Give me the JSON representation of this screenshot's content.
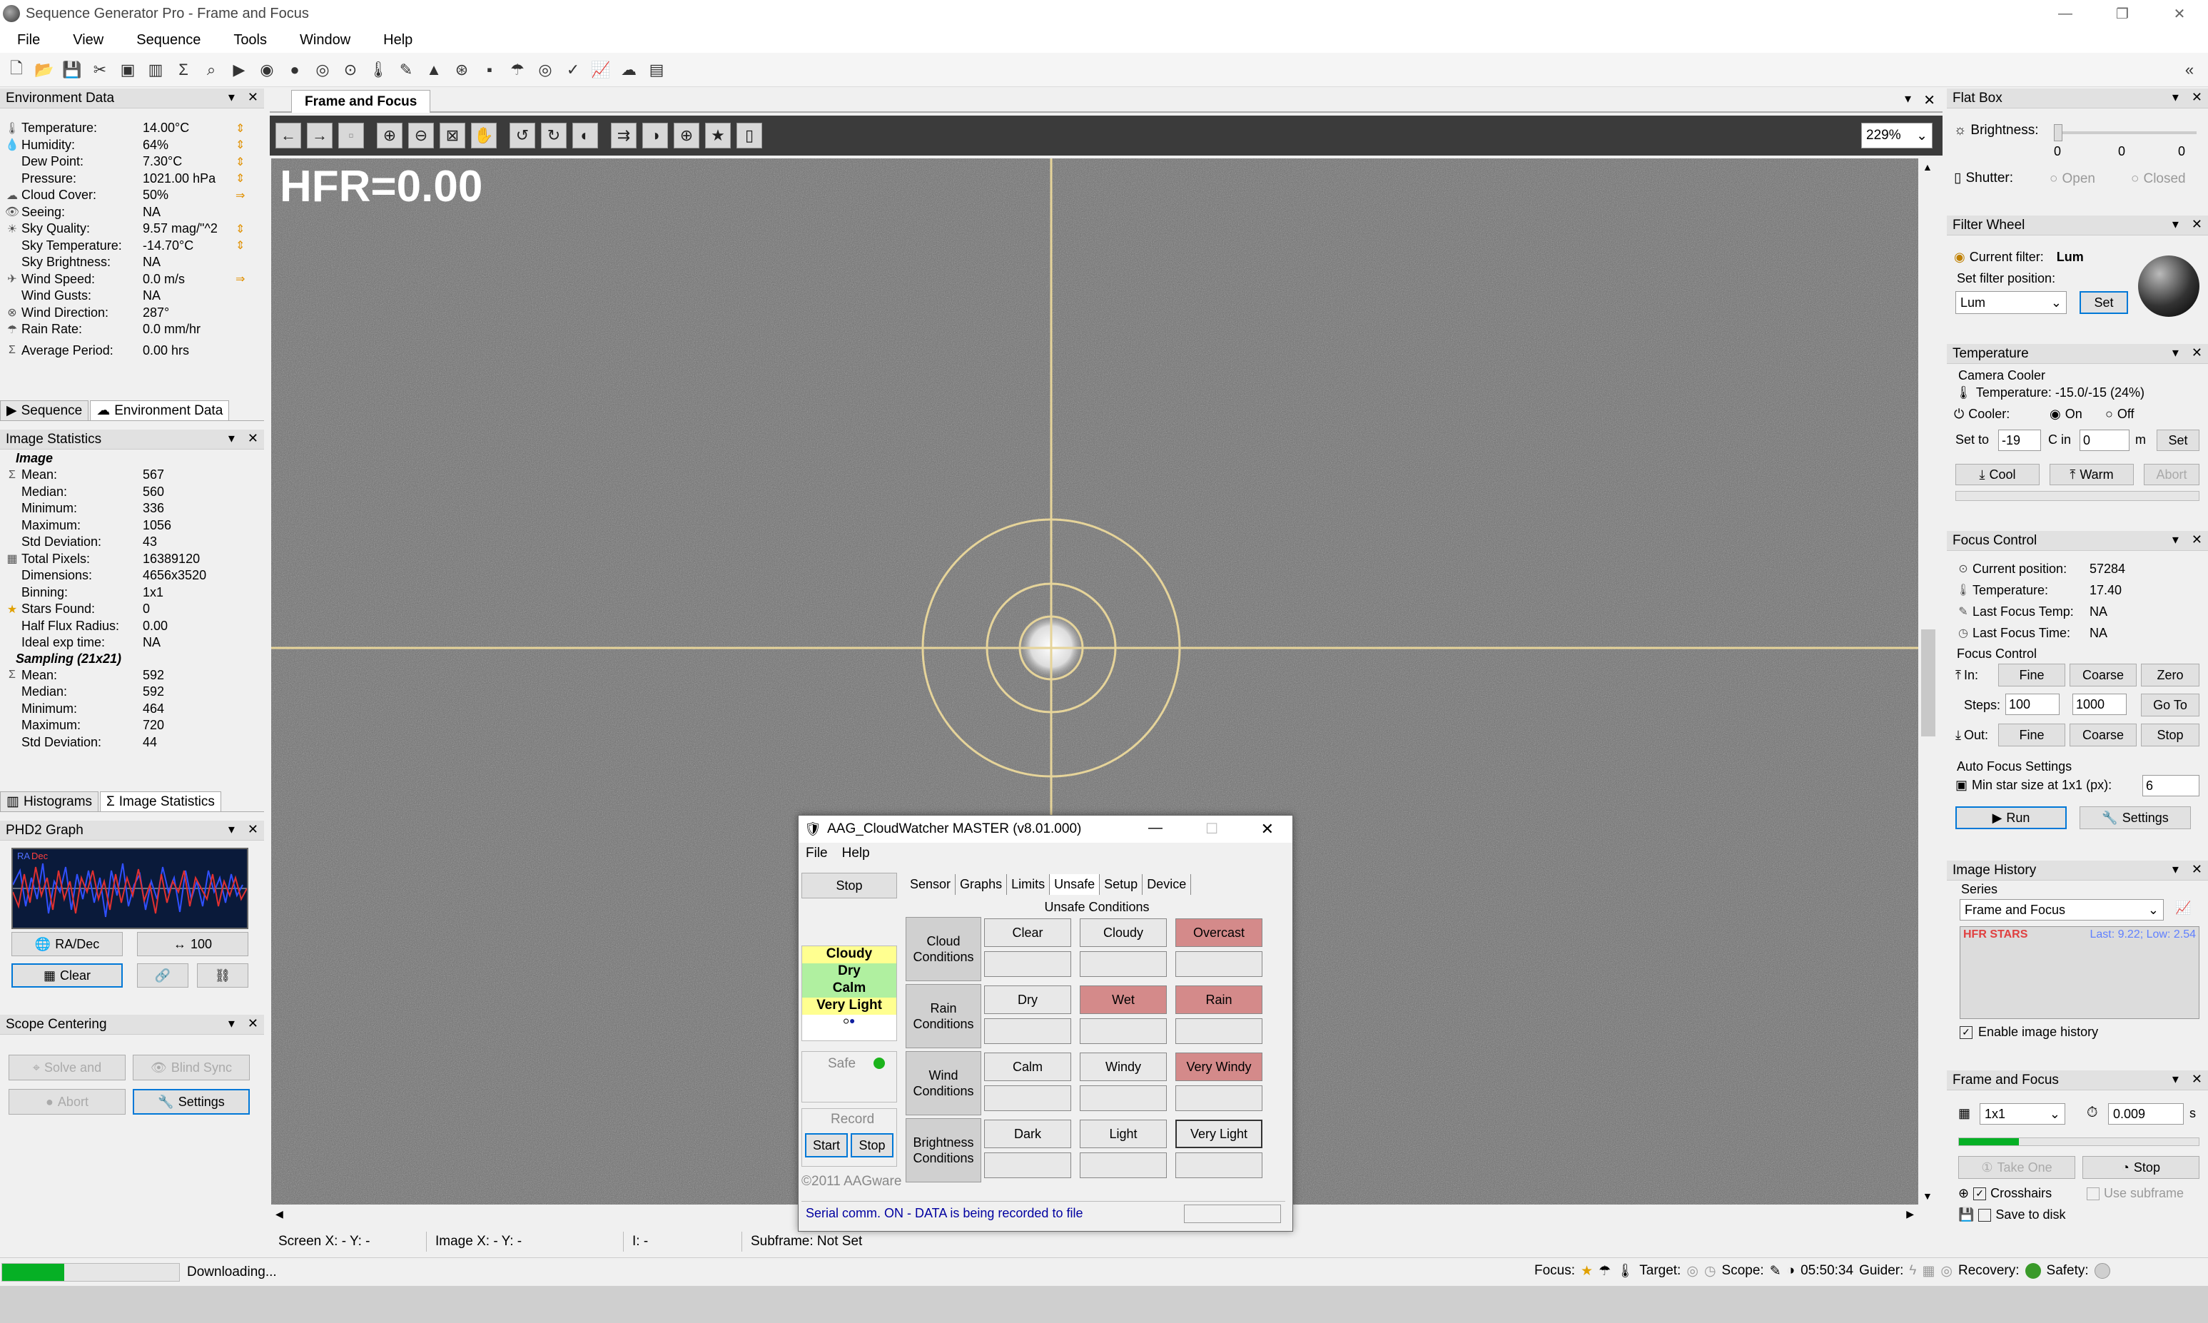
{
  "window": {
    "title": "Sequence Generator Pro - Frame and Focus"
  },
  "menu": [
    "File",
    "View",
    "Sequence",
    "Tools",
    "Window",
    "Help"
  ],
  "env": {
    "title": "Environment Data",
    "rows": [
      {
        "label": "Temperature:",
        "value": "14.00°C"
      },
      {
        "label": "Humidity:",
        "value": "64%"
      },
      {
        "label": "Dew Point:",
        "value": "7.30°C"
      },
      {
        "label": "Pressure:",
        "value": "1021.00 hPa"
      },
      {
        "label": "Cloud Cover:",
        "value": "50%"
      },
      {
        "label": "Seeing:",
        "value": "NA"
      },
      {
        "label": "Sky Quality:",
        "value": "9.57 mag/\"^2"
      },
      {
        "label": "Sky Temperature:",
        "value": "-14.70°C"
      },
      {
        "label": "Sky Brightness:",
        "value": "NA"
      },
      {
        "label": "Wind Speed:",
        "value": "0.0 m/s"
      },
      {
        "label": "Wind Gusts:",
        "value": "NA"
      },
      {
        "label": "Wind Direction:",
        "value": "287°"
      },
      {
        "label": "Rain Rate:",
        "value": "0.0 mm/hr"
      }
    ],
    "avg_label": "Average Period:",
    "avg_value": "0.00 hrs",
    "tab1": "Sequence",
    "tab2": "Environment Data"
  },
  "imgstats": {
    "title": "Image Statistics",
    "image_hdr": "Image",
    "rows": [
      {
        "label": "Mean:",
        "value": "567"
      },
      {
        "label": "Median:",
        "value": "560"
      },
      {
        "label": "Minimum:",
        "value": "336"
      },
      {
        "label": "Maximum:",
        "value": "1056"
      },
      {
        "label": "Std Deviation:",
        "value": "43"
      },
      {
        "label": "Total Pixels:",
        "value": "16389120"
      },
      {
        "label": "Dimensions:",
        "value": "4656x3520"
      },
      {
        "label": "Binning:",
        "value": "1x1"
      },
      {
        "label": "Stars Found:",
        "value": "0"
      },
      {
        "label": "Half Flux Radius:",
        "value": "0.00"
      },
      {
        "label": "Ideal exp time:",
        "value": "NA"
      }
    ],
    "sampling_hdr": "Sampling (21x21)",
    "srows": [
      {
        "label": "Mean:",
        "value": "592"
      },
      {
        "label": "Median:",
        "value": "592"
      },
      {
        "label": "Minimum:",
        "value": "464"
      },
      {
        "label": "Maximum:",
        "value": "720"
      },
      {
        "label": "Std Deviation:",
        "value": "44"
      }
    ],
    "tab1": "Histograms",
    "tab2": "Image Statistics"
  },
  "phd2": {
    "title": "PHD2 Graph",
    "ra": "RA",
    "dec": "Dec",
    "radec_btn": "RA/Dec",
    "scale_btn": "100",
    "clear_btn": "Clear"
  },
  "scope": {
    "title": "Scope Centering",
    "solve": "Solve and",
    "blind": "Blind Sync",
    "abort": "Abort",
    "settings": "Settings"
  },
  "doc": {
    "tab": "Frame and Focus",
    "zoom": "229%",
    "hfr": "HFR=0.00"
  },
  "statusline": {
    "screen": "Screen X: - Y: -",
    "image": "Image X: - Y: -",
    "i": "I: -",
    "subframe": "Subframe: Not Set"
  },
  "flatbox": {
    "title": "Flat Box",
    "brightness": "Brightness:",
    "b_vals": [
      "0",
      "0",
      "0"
    ],
    "shutter": "Shutter:",
    "open": "Open",
    "closed": "Closed"
  },
  "filter": {
    "title": "Filter Wheel",
    "current_lbl": "Current filter:",
    "current": "Lum",
    "set_lbl": "Set filter position:",
    "select": "Lum",
    "set_btn": "Set"
  },
  "temp": {
    "title": "Temperature",
    "cam": "Camera Cooler",
    "temp_line": "Temperature: -15.0/-15 (24%)",
    "cooler": "Cooler:",
    "on": "On",
    "off": "Off",
    "setto": "Set to",
    "setval": "-19",
    "cin": "C in",
    "minval": "0",
    "m": "m",
    "set_btn": "Set",
    "cool": "Cool",
    "warm": "Warm",
    "abort": "Abort"
  },
  "focus": {
    "title": "Focus Control",
    "rows": [
      {
        "label": "Current position:",
        "value": "57284"
      },
      {
        "label": "Temperature:",
        "value": "17.40"
      },
      {
        "label": "Last Focus Temp:",
        "value": "NA"
      },
      {
        "label": "Last Focus Time:",
        "value": "NA"
      }
    ],
    "fc": "Focus Control",
    "in": "In:",
    "fine": "Fine",
    "coarse": "Coarse",
    "zero": "Zero",
    "steps": "Steps:",
    "s1": "100",
    "s2": "1000",
    "goto": "Go To",
    "out": "Out:",
    "stop": "Stop",
    "afs": "Auto Focus Settings",
    "minstar": "Min star size at 1x1 (px):",
    "minstar_val": "6",
    "run": "Run",
    "settings": "Settings"
  },
  "history": {
    "title": "Image History",
    "series_lbl": "Series",
    "series": "Frame and Focus",
    "legend": "HFR  STARS",
    "last": "Last: 9.22; Low: 2.54",
    "enable": "Enable image history"
  },
  "ff": {
    "title": "Frame and Focus",
    "bin": "1x1",
    "exp": "0.009",
    "s": "s",
    "takeone": "Take One",
    "stop": "Stop",
    "crosshairs": "Crosshairs",
    "subframe": "Use subframe",
    "save": "Save to disk",
    "progress": 0.25
  },
  "bottom": {
    "progress": 0.35,
    "downloading": "Downloading...",
    "focus": "Focus:",
    "target": "Target:",
    "scope": "Scope:",
    "time": "05:50:34",
    "guider": "Guider:",
    "recovery": "Recovery:",
    "safety": "Safety:"
  },
  "cw": {
    "title": "AAG_CloudWatcher MASTER (v8.01.000)",
    "menu": [
      "File",
      "Help"
    ],
    "stop": "Stop",
    "tabs": [
      "Sensor",
      "Graphs",
      "Limits",
      "Unsafe",
      "Setup",
      "Device"
    ],
    "status": [
      "Cloudy",
      "Dry",
      "Calm",
      "Very Light"
    ],
    "safe": "Safe",
    "record": "Record",
    "start": "Start",
    "rstop": "Stop",
    "copyright": "©2011 AAGware",
    "unsafe_title": "Unsafe Conditions",
    "groups": [
      {
        "label": "Cloud Conditions",
        "items": [
          "Clear",
          "Cloudy",
          "Overcast"
        ]
      },
      {
        "label": "Rain Conditions",
        "items": [
          "Dry",
          "Wet",
          "Rain"
        ]
      },
      {
        "label": "Wind Conditions",
        "items": [
          "Calm",
          "Windy",
          "Very Windy"
        ]
      },
      {
        "label": "Brightness Conditions",
        "items": [
          "Dark",
          "Light",
          "Very Light"
        ]
      }
    ],
    "status_bar": "Serial comm. ON - DATA is being recorded to file"
  }
}
